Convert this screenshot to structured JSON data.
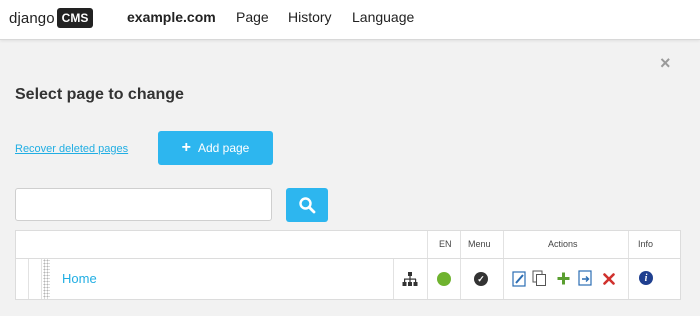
{
  "toolbar": {
    "logo_text": "django",
    "logo_badge": "CMS",
    "site": "example.com",
    "menu_page": "Page",
    "menu_history": "History",
    "menu_language": "Language"
  },
  "panel": {
    "close_glyph": "×",
    "title": "Select page to change",
    "recover_link": "Recover deleted pages",
    "add_button": "Add page",
    "search_value": "",
    "search_placeholder": ""
  },
  "table": {
    "headers": {
      "lang": "EN",
      "menu": "Menu",
      "actions": "Actions",
      "info": "Info"
    },
    "rows": [
      {
        "title": "Home",
        "published_en": true,
        "in_menu": true
      }
    ]
  },
  "icons": {
    "tree": "sitemap-icon",
    "published": "green-dot-icon",
    "menu": "check-circle-icon",
    "edit": "edit-icon",
    "copy": "copy-icon",
    "add_child": "plus-icon",
    "move": "move-icon",
    "delete": "delete-icon",
    "info": "info-icon",
    "search": "search-icon"
  },
  "colors": {
    "accent": "#2db6ef",
    "link": "#21aee3",
    "published": "#6fb32f",
    "delete": "#d0312d",
    "add": "#5a9e2f",
    "info": "#1f3f8f"
  }
}
